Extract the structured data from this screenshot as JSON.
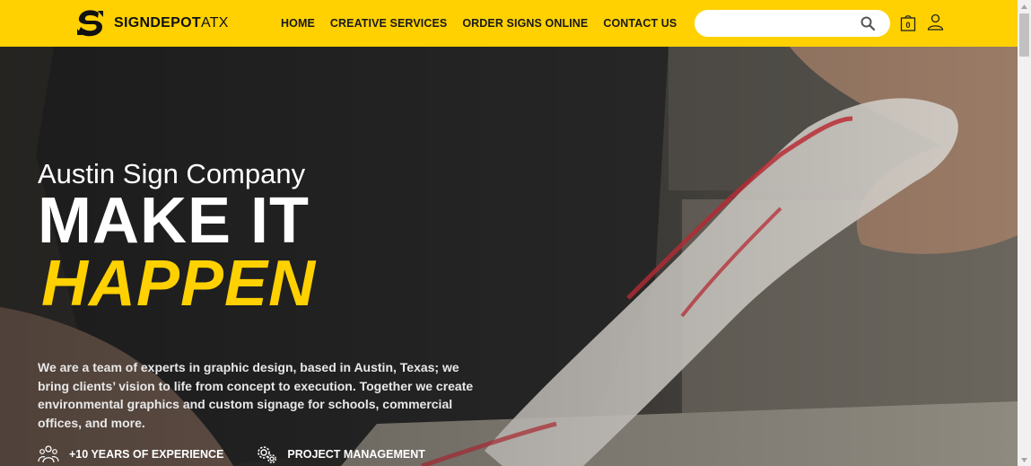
{
  "brand": {
    "name_bold": "SIGNDEPOT",
    "name_light": "ATX"
  },
  "nav": [
    {
      "label": "HOME"
    },
    {
      "label": "CREATIVE SERVICES"
    },
    {
      "label": "ORDER SIGNS ONLINE"
    },
    {
      "label": "CONTACT US"
    }
  ],
  "search": {
    "placeholder": "",
    "value": ""
  },
  "cart": {
    "count": "0"
  },
  "hero": {
    "subtitle": "Austin Sign Company",
    "headline_line1": "MAKE IT",
    "headline_line2": "HAPPEN",
    "description": "We are a team of experts in graphic design, based in Austin, Texas; we bring clients’ vision to life from concept to execution. Together we create environmental graphics and custom signage for schools, commercial offices, and more.",
    "features": [
      {
        "icon": "team-icon",
        "label": "+10 YEARS OF EXPERIENCE"
      },
      {
        "icon": "gears-icon",
        "label": "PROJECT MANAGEMENT"
      }
    ]
  },
  "colors": {
    "accent": "#ffd100",
    "header_text": "#1a1a1a",
    "hero_text": "#ffffff"
  }
}
